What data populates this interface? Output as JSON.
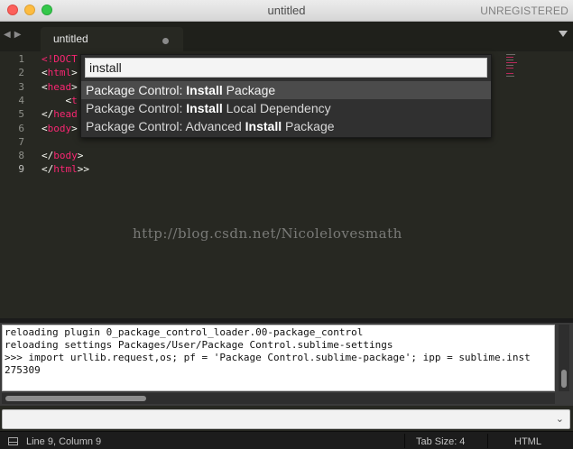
{
  "window": {
    "title": "untitled",
    "license_status": "UNREGISTERED"
  },
  "tabs": [
    {
      "label": "untitled",
      "modified": true
    }
  ],
  "editor": {
    "line_numbers": [
      "1",
      "2",
      "3",
      "4",
      "5",
      "6",
      "7",
      "8",
      "9"
    ],
    "current_line": "9",
    "lines": [
      [
        {
          "t": "<!DOCT",
          "c": "tag"
        }
      ],
      [
        {
          "t": "<",
          "c": ""
        },
        {
          "t": "html",
          "c": "tag"
        },
        {
          "t": ">",
          "c": ""
        }
      ],
      [
        {
          "t": "<",
          "c": ""
        },
        {
          "t": "head",
          "c": "tag"
        },
        {
          "t": ">",
          "c": ""
        }
      ],
      [
        {
          "t": "    <",
          "c": ""
        },
        {
          "t": "t",
          "c": "tag"
        }
      ],
      [
        {
          "t": "</",
          "c": ""
        },
        {
          "t": "head",
          "c": "tag"
        }
      ],
      [
        {
          "t": "<",
          "c": ""
        },
        {
          "t": "body",
          "c": "tag"
        },
        {
          "t": ">",
          "c": ""
        }
      ],
      [],
      [
        {
          "t": "</",
          "c": ""
        },
        {
          "t": "body",
          "c": "tag"
        },
        {
          "t": ">",
          "c": ""
        }
      ],
      [
        {
          "t": "</",
          "c": ""
        },
        {
          "t": "html",
          "c": "tag"
        },
        {
          "t": ">>",
          "c": ""
        }
      ]
    ]
  },
  "command_palette": {
    "query": "install",
    "selected_index": 0,
    "items": [
      {
        "prefix": "Package Control: ",
        "match": "Install",
        "suffix": " Package"
      },
      {
        "prefix": "Package Control: ",
        "match": "Install",
        "suffix": " Local Dependency"
      },
      {
        "prefix": "Package Control: Advanced ",
        "match": "Install",
        "suffix": " Package"
      }
    ]
  },
  "watermark": "http://blog.csdn.net/Nicolelovesmath",
  "console": {
    "output_lines": [
      "reloading plugin 0_package_control_loader.00-package_control",
      "reloading settings Packages/User/Package Control.sublime-settings",
      ">>> import urllib.request,os; pf = 'Package Control.sublime-package'; ipp = sublime.inst",
      "275309"
    ],
    "input_value": ""
  },
  "status_bar": {
    "position": "Line 9, Column 9",
    "tab_size": "Tab Size: 4",
    "syntax": "HTML"
  },
  "colors": {
    "background": "#272822",
    "tag": "#f92672",
    "text": "#f8f8f2",
    "gutter_text": "#8f908a"
  }
}
